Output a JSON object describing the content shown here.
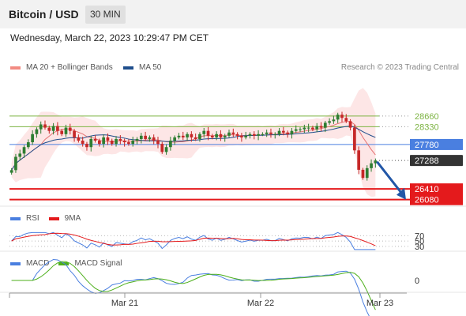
{
  "header": {
    "title": "Bitcoin / USD",
    "timeframe": "30 MIN"
  },
  "date_text": "Wednesday, March 22, 2023 10:29:47 PM CET",
  "legend": {
    "ma20": {
      "label": "MA 20 + Bollinger Bands",
      "color": "#f28b82"
    },
    "ma50": {
      "label": "MA 50",
      "color": "#1f4e8c"
    }
  },
  "research": "Research © 2023 Trading Central",
  "rsi_legend": {
    "rsi": "RSI",
    "ma": "9MA"
  },
  "macd_legend": {
    "macd": "MACD",
    "signal": "MACD Signal"
  },
  "chart_data": {
    "type": "candlestick",
    "price_range": [
      25950,
      29850
    ],
    "close_series": [
      26990,
      27400,
      27500,
      27700,
      27850,
      28100,
      28250,
      28400,
      28300,
      28200,
      28350,
      28200,
      28100,
      28300,
      28200,
      28000,
      27900,
      27800,
      27700,
      27950,
      27900,
      27800,
      28000,
      27900,
      27800,
      27950,
      27900,
      27850,
      27800,
      27900,
      27950,
      28050,
      27950,
      28000,
      27900,
      27800,
      27550,
      27700,
      27900,
      28000,
      28050,
      28000,
      28100,
      28000,
      27950,
      28100,
      28200,
      28050,
      28000,
      28100,
      28000,
      28050,
      28150,
      28100,
      28050,
      28000,
      28050,
      28100,
      28050,
      28100,
      28100,
      28150,
      28100,
      28100,
      28200,
      28150,
      28100,
      28200,
      28250,
      28250,
      28300,
      28300,
      28250,
      28350,
      28300,
      28450,
      28500,
      28550,
      28700,
      28600,
      28500,
      28300,
      27600,
      27000,
      26750,
      27050,
      27200,
      27288
    ],
    "levels": [
      {
        "value": 28660,
        "label": "28660",
        "kind": "resistance"
      },
      {
        "value": 28330,
        "label": "28330",
        "kind": "resistance"
      },
      {
        "value": 27780,
        "label": "27780",
        "kind": "pivot"
      },
      {
        "value": 27288,
        "label": "27288",
        "kind": "current"
      },
      {
        "value": 26410,
        "label": "26410",
        "kind": "target"
      },
      {
        "value": 26080,
        "label": "26080",
        "kind": "target"
      }
    ],
    "x_labels": [
      "Mar 21",
      "Mar 22",
      "Mar 23"
    ],
    "rsi": {
      "levels": [
        "70",
        "50",
        "30"
      ]
    },
    "macd": {
      "zero_label": "0"
    }
  },
  "colors": {
    "resistance": "#7cb342",
    "pivot": "#4a7fe0",
    "target": "#e41a1c",
    "current": "#333333",
    "band": "#fde2e2",
    "up": "#2e7d32",
    "down": "#c62828",
    "arrow": "#2257a7"
  }
}
